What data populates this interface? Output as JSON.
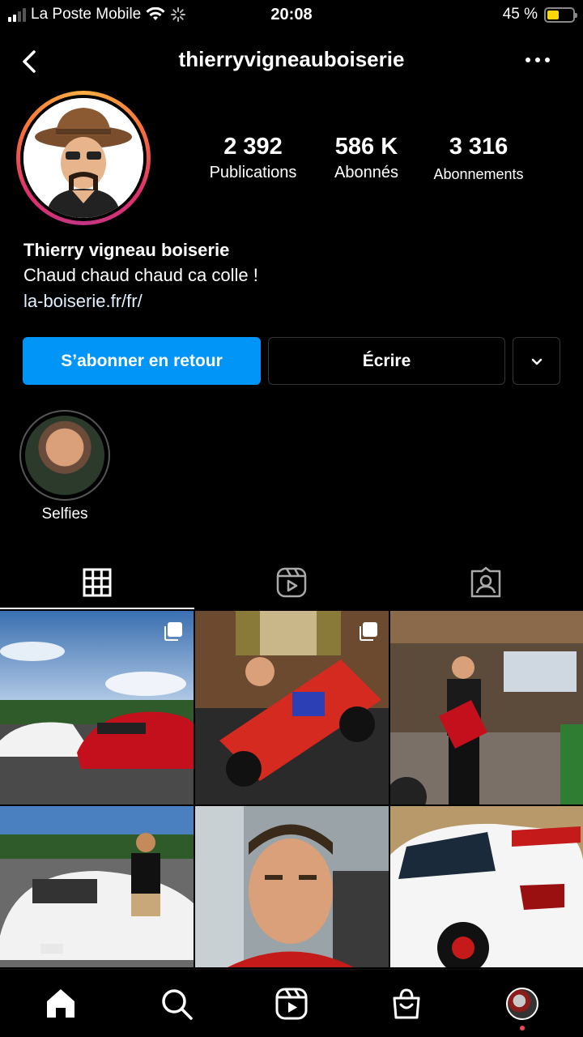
{
  "status_bar": {
    "carrier": "La Poste Mobile",
    "time": "20:08",
    "battery_text": "45 %",
    "battery_level": 0.45
  },
  "header": {
    "username": "thierryvigneauboiserie"
  },
  "profile": {
    "stats": [
      {
        "value": "2 392",
        "label": "Publications"
      },
      {
        "value": "586 K",
        "label": "Abonnés"
      },
      {
        "value": "3 316",
        "label": "Abonnements"
      }
    ],
    "name": "Thierry vigneau boiserie",
    "bio": "Chaud chaud chaud ca colle !",
    "link": "la-boiserie.fr/fr/"
  },
  "actions": {
    "follow_back": "S’abonner en retour",
    "write": "Écrire"
  },
  "highlights": [
    {
      "label": "Selfies"
    }
  ],
  "colors": {
    "accent": "#0095f6",
    "background": "#000000",
    "notification_dot": "#ed4956"
  },
  "icons": [
    "back-arrow-icon",
    "more-dots-icon",
    "grid-icon",
    "reels-icon",
    "tagged-icon",
    "home-icon",
    "search-icon",
    "reels-icon",
    "shop-icon"
  ]
}
